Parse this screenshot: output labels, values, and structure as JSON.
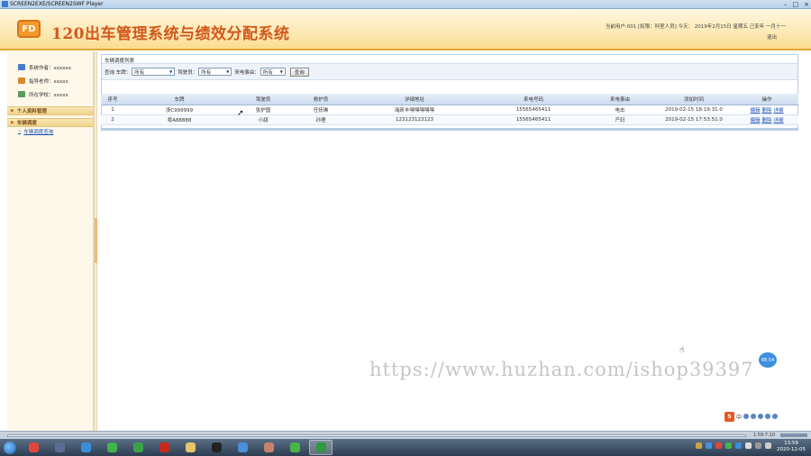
{
  "player": {
    "title": "SCREEN2EXE/SCREEN2SWF Player",
    "controls": [
      "–",
      "□",
      "×"
    ]
  },
  "header": {
    "logo_text": "FD",
    "app_title": "120出车管理系统与绩效分配系统",
    "user_info": "当前用户:001 [权限：科室人员] 今天： 2019年2月15日 星期五 己亥年 一月十一",
    "logout": "退出"
  },
  "sidebar": {
    "info": [
      {
        "label": "系统作者：xxxxxx",
        "icon": "author-icon",
        "color": "#4a7cc9"
      },
      {
        "label": "指导老师：xxxxx",
        "icon": "teacher-icon",
        "color": "#d68a2a"
      },
      {
        "label": "所在学校：xxxxx",
        "icon": "school-icon",
        "color": "#5a9a5a"
      }
    ],
    "groups": [
      {
        "title": "个人资料管理",
        "items": []
      },
      {
        "title": "车辆调度",
        "items": [
          "车辆调度查询"
        ]
      }
    ]
  },
  "panel": {
    "title": "车辆调度列表",
    "filter": {
      "query_label": "查询 车牌：",
      "plate_value": "所有",
      "driver_label": "驾驶员：",
      "driver_value": "所有",
      "event_label": "来电事由：",
      "event_value": "所有",
      "search_button": "查询"
    }
  },
  "table": {
    "headers": [
      "序号",
      "车牌",
      "驾驶员",
      "救护员",
      "详细地址",
      "来电号码",
      "来电事由",
      "添加时间",
      "操作"
    ],
    "rows": [
      [
        "1",
        "浙C999999",
        "张护国",
        "任抚琳",
        "瑞昕丰嘿嘿嘿嘿嘿",
        "15565465411",
        "电击",
        "2019-02-15 18:19:31.0"
      ],
      [
        "2",
        "粤A88888",
        "小翃",
        "孙狸",
        "123123123123",
        "15565465411",
        "产妇",
        "2019-02-15 17:53:51.0"
      ]
    ],
    "ops": [
      "编辑",
      "删除",
      "详细"
    ]
  },
  "overlay": {
    "float_badge": "88.54",
    "watermark": "https://www.huzhan.com/ishop39397"
  },
  "ime": {
    "logo": "S",
    "mode": "中",
    "items": [
      "ime-punct-icon",
      "ime-voice-icon",
      "ime-keyboard-icon",
      "ime-skin-icon",
      "ime-tools-icon"
    ]
  },
  "player_ctrl": {
    "time": "1:59:7:10"
  },
  "taskbar": {
    "apps": [
      {
        "name": "chrome-app",
        "color": "#e0463a"
      },
      {
        "name": "media-app",
        "color": "#5a6e94"
      },
      {
        "name": "explorer-app",
        "color": "#3a8fd9"
      },
      {
        "name": "ie-app",
        "color": "#3fb54a"
      },
      {
        "name": "chart-app",
        "color": "#3aa34a"
      },
      {
        "name": "flash-app",
        "color": "#c8281e"
      },
      {
        "name": "folder-app",
        "color": "#e7c36a"
      },
      {
        "name": "qq-app",
        "color": "#222222"
      },
      {
        "name": "ball-app",
        "color": "#4a8fd9"
      },
      {
        "name": "avatar-app",
        "color": "#c9826a"
      },
      {
        "name": "wechat-app",
        "color": "#48b548"
      },
      {
        "name": "player-app",
        "color": "#2e9a3e"
      }
    ],
    "clock_time": "13:59",
    "clock_date": "2020-12-05"
  }
}
